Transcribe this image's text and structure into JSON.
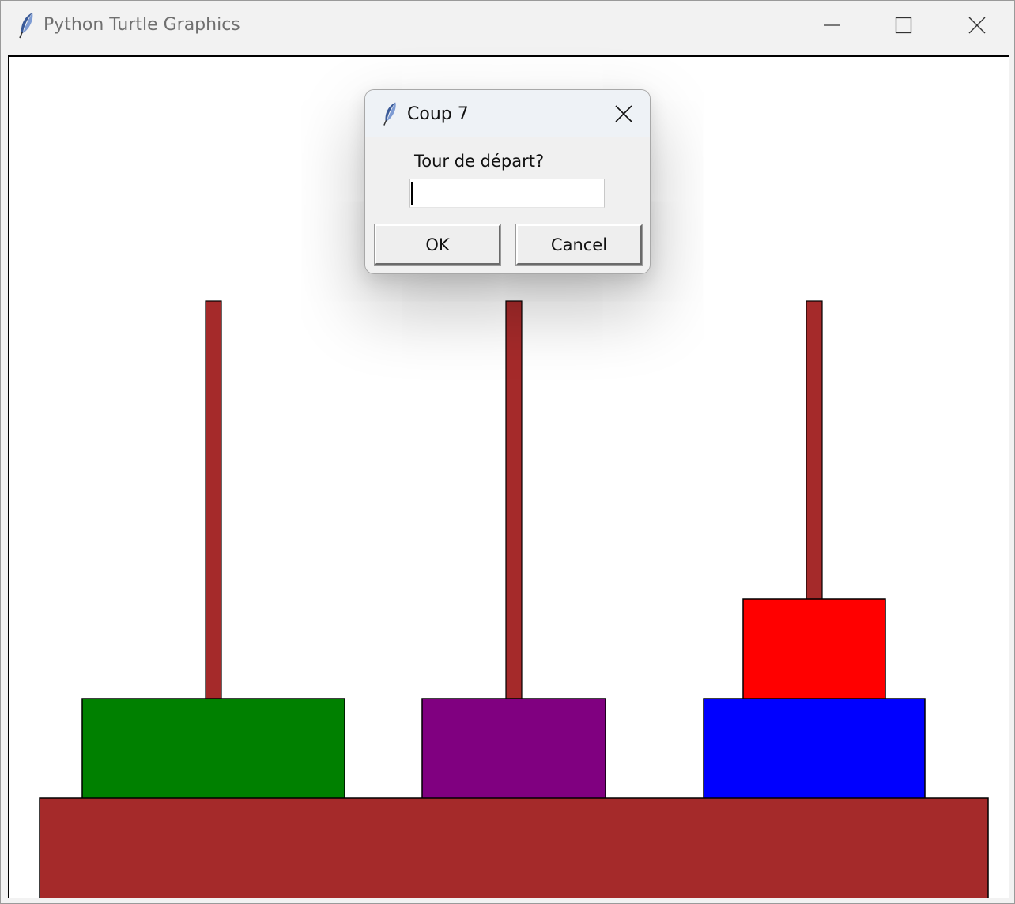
{
  "window": {
    "title": "Python Turtle Graphics",
    "icon": "feather-icon",
    "controls": [
      "minimize-icon",
      "maximize-icon",
      "close-icon"
    ]
  },
  "scene": {
    "base_color": "#a52a2a",
    "pegs": [
      {
        "name": "peg-left",
        "color": "#a52a2a"
      },
      {
        "name": "peg-middle",
        "color": "#a52a2a"
      },
      {
        "name": "peg-right",
        "color": "#a52a2a"
      }
    ],
    "disks": [
      {
        "name": "green-disk",
        "peg": 1,
        "level": 1,
        "color": "#008000"
      },
      {
        "name": "purple-disk",
        "peg": 2,
        "level": 1,
        "color": "#800080"
      },
      {
        "name": "blue-disk",
        "peg": 3,
        "level": 1,
        "color": "#0000ff"
      },
      {
        "name": "red-disk",
        "peg": 3,
        "level": 2,
        "color": "#ff0000"
      }
    ]
  },
  "dialog": {
    "title": "Coup 7",
    "icon": "feather-icon",
    "prompt": "Tour de départ?",
    "input_value": "",
    "ok_label": "OK",
    "cancel_label": "Cancel"
  }
}
